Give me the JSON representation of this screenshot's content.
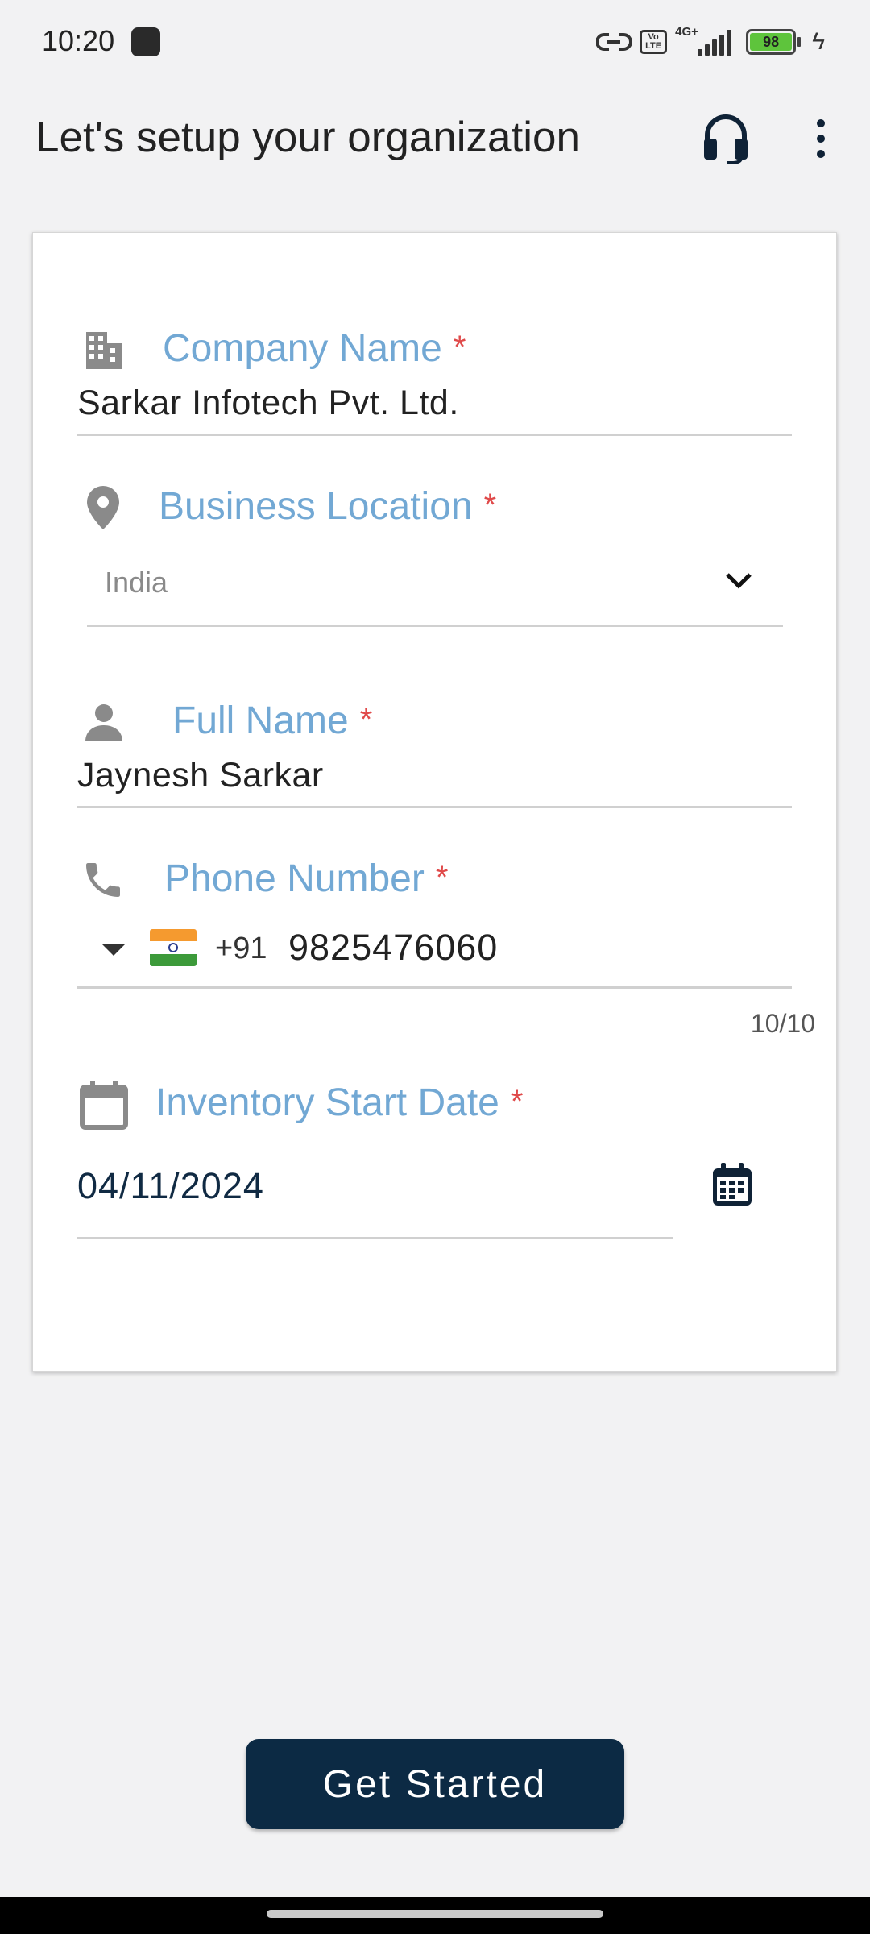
{
  "status_bar": {
    "time": "10:20",
    "network": "4G+",
    "volte": "Vo LTE",
    "battery": "98",
    "icons": [
      "app-notification-icon",
      "link-icon",
      "volte-icon",
      "signal-icon",
      "battery-icon",
      "charging-icon"
    ]
  },
  "app_bar": {
    "title": "Let's setup your organization",
    "icons": [
      "headset-icon",
      "more-vert-icon"
    ]
  },
  "form": {
    "company": {
      "label": "Company Name",
      "required": "*",
      "value": "Sarkar Infotech Pvt. Ltd.",
      "icon": "building-icon"
    },
    "location": {
      "label": "Business Location",
      "required": "*",
      "value": "India",
      "icon": "location-pin-icon"
    },
    "full_name": {
      "label": "Full Name",
      "required": "*",
      "value": "Jaynesh Sarkar",
      "icon": "person-icon"
    },
    "phone": {
      "label": "Phone Number",
      "required": "*",
      "dial_code": "+91",
      "value": "9825476060",
      "counter": "10/10",
      "icon": "phone-icon",
      "country_flag": "india-flag-icon"
    },
    "start_date": {
      "label": "Inventory Start Date",
      "required": "*",
      "value": "04/11/2024",
      "icon": "calendar-icon"
    }
  },
  "actions": {
    "primary_label": "Get Started"
  },
  "colors": {
    "label": "#72a8d4",
    "required": "#e04a4a",
    "primary_button": "#0c2a44",
    "background": "#f2f2f3"
  }
}
